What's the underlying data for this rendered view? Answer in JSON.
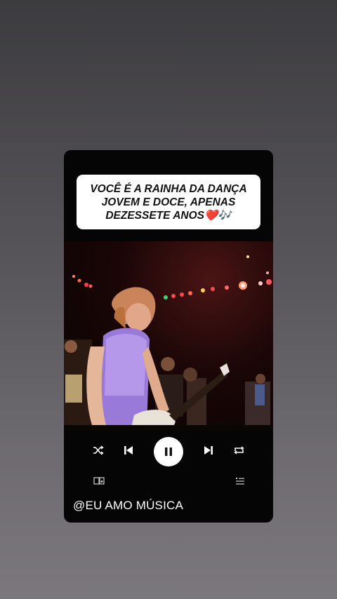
{
  "caption": {
    "line1": "VOCÊ É A RAINHA DA DANÇA",
    "line2": "JOVEM E DOCE, APENAS",
    "line3": "DEZESSETE ANOS❤️🎶"
  },
  "video": {
    "description_icon": "concert-video"
  },
  "controls": {
    "shuffle": "shuffle-icon",
    "previous": "previous-icon",
    "pause": "pause-icon",
    "next": "next-icon",
    "repeat": "repeat-icon",
    "devices": "devices-icon",
    "queue": "queue-icon"
  },
  "handle": "@EU AMO MÚSICA",
  "colors": {
    "card": "#050505",
    "caption_bg": "#ffffff",
    "accent": "#ffffff"
  }
}
